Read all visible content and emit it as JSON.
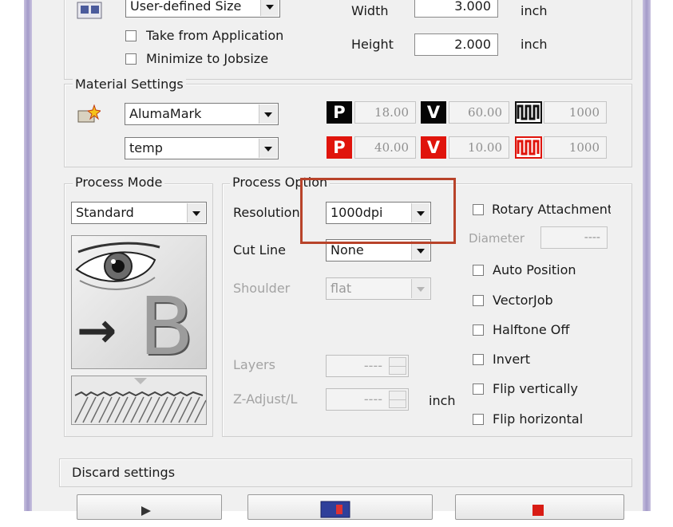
{
  "page_setup": {
    "size_combo": "User-defined Size",
    "take_from_application": "Take from Application",
    "minimize_to_jobsize": "Minimize to Jobsize",
    "width_label": "Width",
    "width_value": "3.000",
    "width_unit": "inch",
    "height_label": "Height",
    "height_value": "2.000",
    "height_unit": "inch"
  },
  "material": {
    "legend": "Material Settings",
    "material_combo": "AlumaMark",
    "sub_combo": "temp",
    "row1": {
      "p_label": "P",
      "p_value": "18.00",
      "v_label": "V",
      "v_value": "60.00",
      "f_value": "1000"
    },
    "row2": {
      "p_label": "P",
      "p_value": "40.00",
      "v_label": "V",
      "v_value": "10.00",
      "f_value": "1000"
    }
  },
  "process_mode": {
    "legend": "Process Mode",
    "mode": "Standard"
  },
  "process_options": {
    "legend": "Process Option",
    "resolution_label": "Resolution",
    "resolution_value": "1000dpi",
    "cutline_label": "Cut Line",
    "cutline_value": "None",
    "shoulder_label": "Shoulder",
    "shoulder_value": "flat",
    "layers_label": "Layers",
    "layers_value": "----",
    "zadjust_label": "Z-Adjust/L",
    "zadjust_value": "----",
    "zadjust_unit": "inch"
  },
  "options_right": {
    "rotary": "Rotary Attachment",
    "diameter_label": "Diameter",
    "diameter_value": "----",
    "auto_position": "Auto Position",
    "vector_job": "VectorJob",
    "halftone_off": "Halftone Off",
    "invert": "Invert",
    "flip_vertically": "Flip vertically",
    "flip_horizontal": "Flip horizontal"
  },
  "illustration": {
    "letter": "B",
    "arrow": "→"
  },
  "discard": "Discard settings",
  "colors": {
    "accent_red": "#e0140c",
    "highlight": "#b8432a",
    "frame": "#a49bc9"
  }
}
